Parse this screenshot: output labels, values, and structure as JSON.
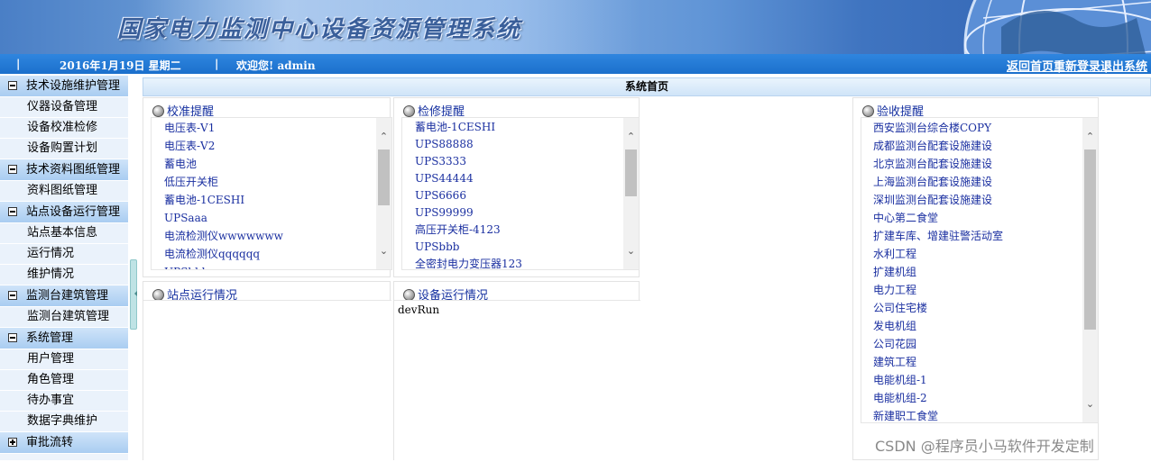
{
  "banner": {
    "title": "国家电力监测中心设备资源管理系统"
  },
  "infobar": {
    "date": "2016年1月19日  星期二",
    "welcome": "欢迎您!   admin",
    "links": [
      "返回首页",
      "重新登录",
      "退出系统"
    ]
  },
  "sidebar": {
    "groups": [
      {
        "title": "技术设施维护管理",
        "items": [
          "仪器设备管理",
          "设备校准检修",
          "设备购置计划"
        ]
      },
      {
        "title": "技术资料图纸管理",
        "items": [
          "资料图纸管理"
        ]
      },
      {
        "title": "站点设备运行管理",
        "items": [
          "站点基本信息",
          "运行情况",
          "维护情况"
        ]
      },
      {
        "title": "监测台建筑管理",
        "items": [
          "监测台建筑管理"
        ]
      },
      {
        "title": "系统管理",
        "items": [
          "用户管理",
          "角色管理",
          "待办事宜",
          "数据字典维护"
        ]
      },
      {
        "title": "审批流转",
        "items": []
      }
    ]
  },
  "main": {
    "title": "系统首页",
    "calibration": {
      "title": "校准提醒",
      "items": [
        "电压表-V1",
        "电压表-V2",
        "蓄电池",
        "低压开关柜",
        "蓄电池-1CESHI",
        "UPSaaa",
        "电流检测仪wwwwwww",
        "电流检测仪qqqqqq",
        "UPSbbb"
      ]
    },
    "repair": {
      "title": "检修提醒",
      "items": [
        "蓄电池-1CESHI",
        "UPS88888",
        "UPS3333",
        "UPS44444",
        "UPS6666",
        "UPS99999",
        "高压开关柜-4123",
        "UPSbbb",
        "全密封电力变压器123"
      ]
    },
    "acceptance": {
      "title": "验收提醒",
      "items": [
        "西安监测台综合楼COPY",
        "成都监测台配套设施建设",
        "北京监测台配套设施建设",
        "上海监测台配套设施建设",
        "深圳监测台配套设施建设",
        "中心第二食堂",
        "扩建车库、增建驻警活动室",
        "水利工程",
        "扩建机组",
        "电力工程",
        "公司住宅楼",
        "发电机组",
        "公司花园",
        "建筑工程",
        "电能机组-1",
        "电能机组-2",
        "新建职工食堂"
      ]
    },
    "site_status": {
      "title": "站点运行情况"
    },
    "device_status": {
      "title": "设备运行情况",
      "content": "devRun"
    }
  },
  "watermark": "CSDN @程序员小马软件开发定制",
  "colors": {
    "infobar": "#1b6fcc",
    "link_text": "#1a2fa0",
    "sidebar_head": "#a9cdf1"
  }
}
